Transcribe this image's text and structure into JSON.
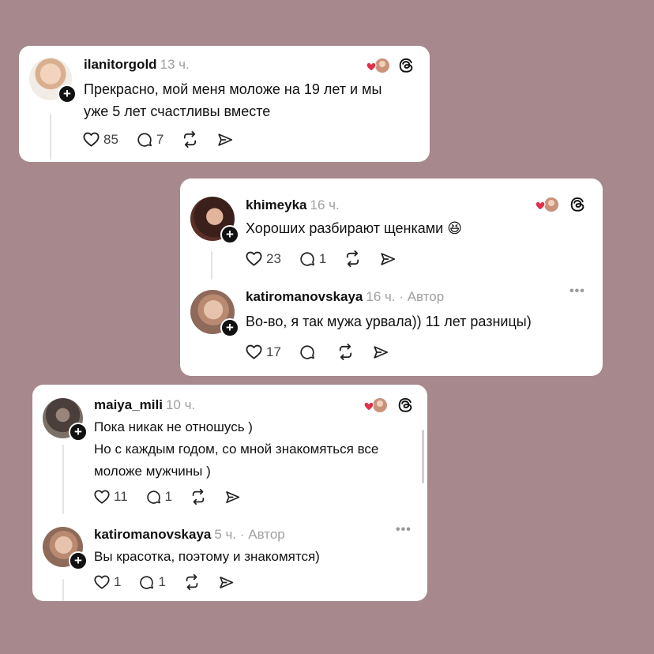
{
  "colors": {
    "background": "#a6888d",
    "card": "#ffffff",
    "heart": "#e0304a",
    "muted": "#a0a0a0"
  },
  "cards": [
    {
      "posts": [
        {
          "username": "ilanitorgold",
          "time": "13 ч.",
          "author_tag": "",
          "lines": [
            "Прекрасно, мой меня моложе на 19 лет и мы",
            "уже 5 лет счастливы вместе"
          ],
          "likes": "85",
          "replies": "7"
        }
      ]
    },
    {
      "posts": [
        {
          "username": "khimeyka",
          "time": "16 ч.",
          "author_tag": "",
          "lines": [
            "Хороших разбирают щенками 😆"
          ],
          "likes": "23",
          "replies": "1"
        },
        {
          "username": "katiromanovskaya",
          "time": "16 ч. · Автор",
          "author_tag": "",
          "lines": [
            "Во-во, я так мужа урвала)) 11 лет разницы)"
          ],
          "likes": "17",
          "replies": ""
        }
      ]
    },
    {
      "posts": [
        {
          "username": "maiya_mili",
          "time": "10 ч.",
          "author_tag": "",
          "lines": [
            "Пока никак не отношусь )",
            "Но с каждым годом, со мной знакомяться все",
            "моложе мужчины )"
          ],
          "likes": "11",
          "replies": "1"
        },
        {
          "username": "katiromanovskaya",
          "time": "5 ч. · Автор",
          "author_tag": "",
          "lines": [
            "Вы красотка, поэтому и знакомятся)"
          ],
          "likes": "1",
          "replies": "1"
        }
      ]
    }
  ],
  "icons": {
    "like": "heart-outline-icon",
    "reply": "comment-bubble-icon",
    "repost": "repost-arrows-icon",
    "share": "send-icon",
    "threads": "threads-logo-icon",
    "more": "more-dots-icon"
  }
}
